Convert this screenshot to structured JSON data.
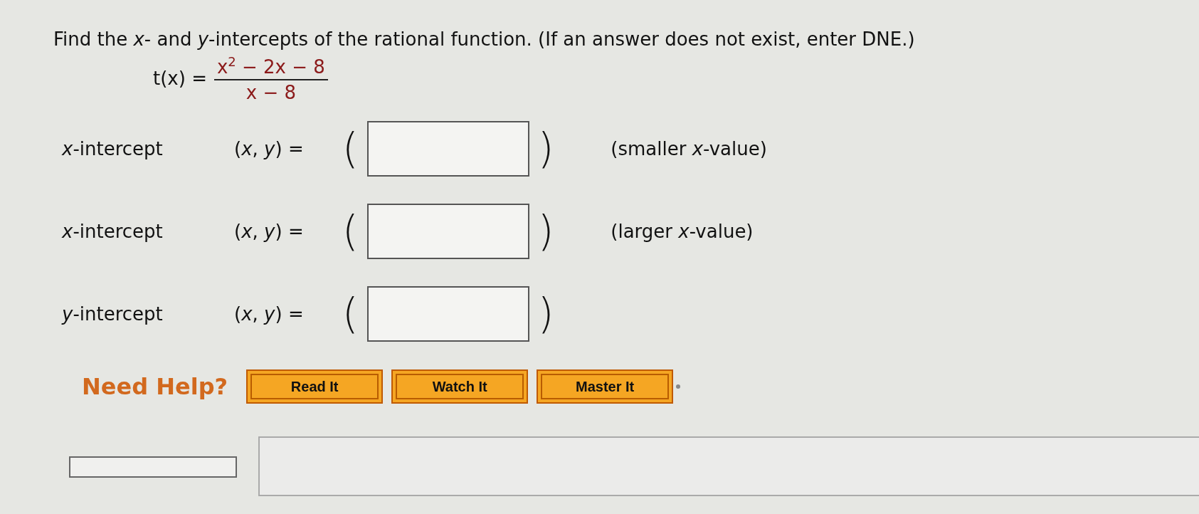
{
  "question": "Find the *x*- and *y*-intercepts of the rational function. (If an answer does not exist, enter DNE.)",
  "function": {
    "name": "t(x) =",
    "numerator": "x$^{2}$ − 2x − 8",
    "denominator": "x − 8"
  },
  "answers": [
    {
      "label": "*x*-intercept",
      "point": "(*x*, *y*) =",
      "open": "(",
      "close": ")",
      "note": "(smaller *x*-value)"
    },
    {
      "label": "*x*-intercept",
      "point": "(*x*, *y*) =",
      "open": "(",
      "close": ")",
      "note": "(larger *x*-value)"
    },
    {
      "label": "*y*-intercept",
      "point": "(*x*, *y*) =",
      "open": "(",
      "close": ")"
    }
  ],
  "help": {
    "title": "Need Help?",
    "buttons": [
      "Read It",
      "Watch It",
      "Master It"
    ]
  }
}
